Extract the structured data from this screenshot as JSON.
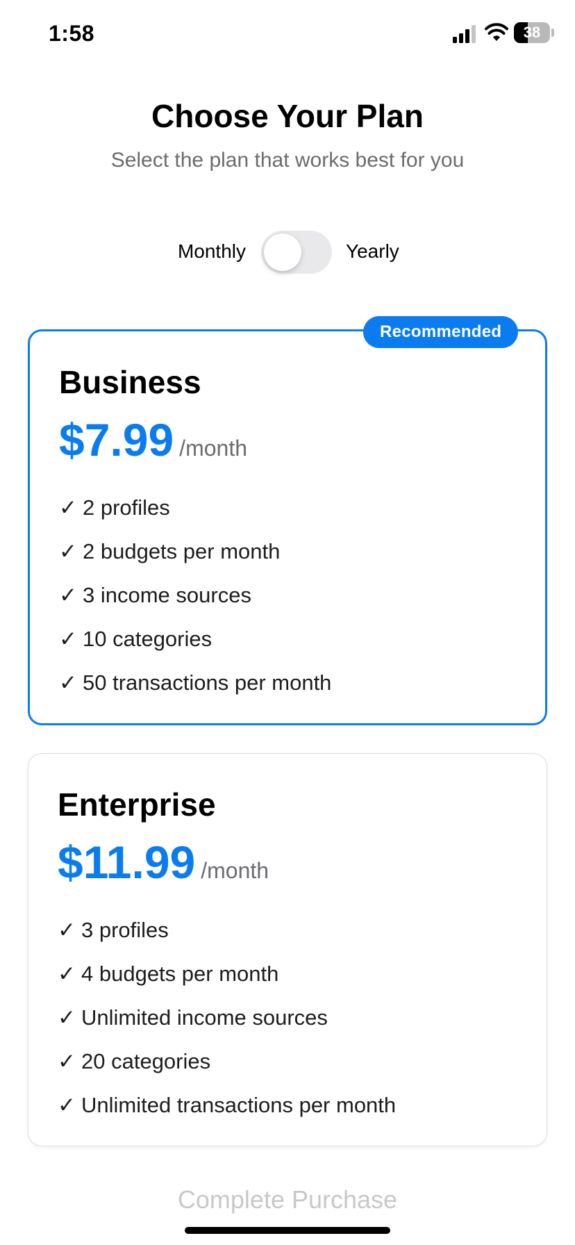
{
  "status_bar": {
    "time": "1:58",
    "battery": "38",
    "icons": [
      "signal-icon",
      "wifi-icon",
      "battery-icon"
    ]
  },
  "header": {
    "title": "Choose Your Plan",
    "subtitle": "Select the plan that works best for you"
  },
  "billing_toggle": {
    "monthly_label": "Monthly",
    "yearly_label": "Yearly",
    "selected": "Monthly"
  },
  "plans": [
    {
      "name": "Business",
      "badge": "Recommended",
      "price": "$7.99",
      "period": "/month",
      "check_glyph": "✓",
      "features": [
        "2 profiles",
        "2 budgets per month",
        "3 income sources",
        "10 categories",
        "50 transactions per month"
      ]
    },
    {
      "name": "Enterprise",
      "price": "$11.99",
      "period": "/month",
      "check_glyph": "✓",
      "features": [
        "3 profiles",
        "4 budgets per month",
        "Unlimited income sources",
        "20 categories",
        "Unlimited transactions per month"
      ]
    }
  ],
  "footer": {
    "purchase_label": "Complete Purchase"
  },
  "colors": {
    "accent": "#0a7cf0",
    "muted_text": "#6b6b70",
    "disabled_text": "#c8c8cc",
    "switch_track": "#e9e9eb"
  }
}
